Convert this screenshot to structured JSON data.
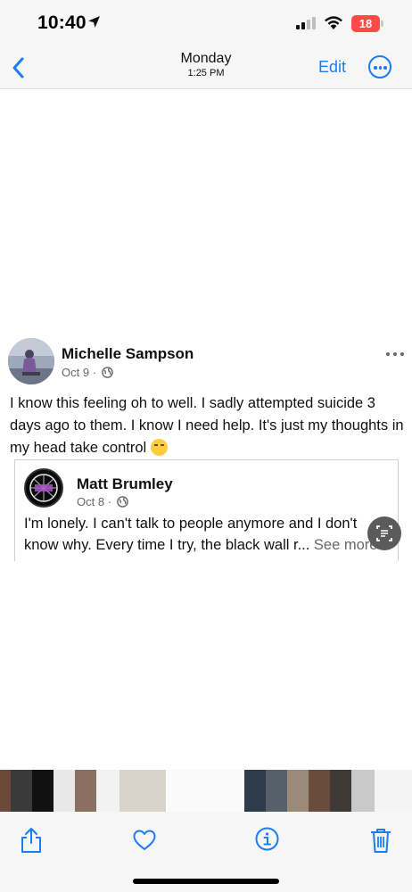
{
  "status_bar": {
    "time": "10:40",
    "battery": "18",
    "icons": [
      "location-arrow-icon",
      "signal-icon",
      "wifi-icon",
      "battery-icon"
    ]
  },
  "nav": {
    "day": "Monday",
    "time": "1:25 PM",
    "edit_label": "Edit",
    "icons": [
      "back-chevron-icon",
      "more-options-icon"
    ]
  },
  "post": {
    "author": "Michelle Sampson",
    "date": "Oct 9",
    "separator": "·",
    "privacy_icon": "globe-icon",
    "text": "I know this feeling oh to well. I sadly attempted suicide 3 days ago to them. I know I need help. It's just my thoughts in my head take control",
    "emoji": "crying-face-emoji",
    "shared": {
      "author": "Matt Brumley",
      "date": "Oct 8",
      "separator": "·",
      "line1": "I'm lonely. I can't talk to people anymore and I don't",
      "line2": "know why. Every time I try, the black wall r...",
      "see_more": "See more"
    }
  },
  "toolbar": {
    "icons": [
      "share-icon",
      "heart-icon",
      "info-icon",
      "trash-icon"
    ]
  },
  "colors": {
    "accent": "#1e7cf2",
    "battery": "#ff4b47",
    "meta_gray": "#65676b",
    "bar_bg": "#f6f6f6"
  }
}
